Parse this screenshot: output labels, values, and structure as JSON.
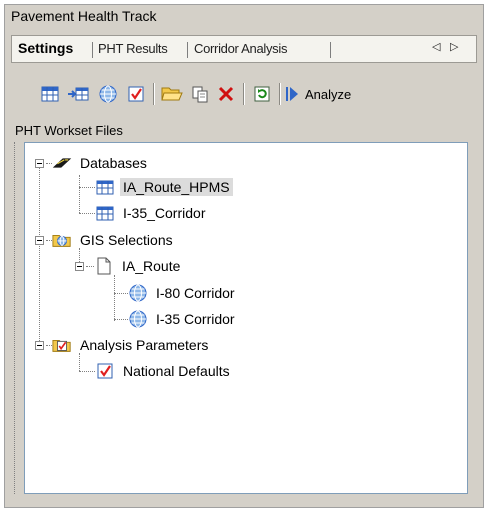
{
  "window": {
    "title": "Pavement Health Track"
  },
  "tabs": [
    {
      "label": "Settings",
      "active": true
    },
    {
      "label": "PHT Results",
      "active": false
    },
    {
      "label": "Corridor Analysis",
      "active": false
    }
  ],
  "toolbar": {
    "buttons": [
      {
        "icon": "table-icon"
      },
      {
        "icon": "import-table-icon"
      },
      {
        "icon": "globe-icon"
      },
      {
        "icon": "checklist-icon"
      },
      {
        "icon": "open-folder-icon"
      },
      {
        "icon": "copy-icon"
      },
      {
        "icon": "delete-icon"
      },
      {
        "icon": "refresh-icon"
      }
    ],
    "analyze_label": "Analyze"
  },
  "section": {
    "label": "PHT Workset Files"
  },
  "tree": {
    "databases": {
      "label": "Databases",
      "children": [
        "IA_Route_HPMS",
        "I-35_Corridor"
      ],
      "selected": "IA_Route_HPMS"
    },
    "gis": {
      "label": "GIS Selections",
      "route": {
        "label": "IA_Route",
        "children": [
          "I-80 Corridor",
          "I-35 Corridor"
        ]
      }
    },
    "analysis": {
      "label": "Analysis Parameters",
      "children": [
        "National Defaults"
      ]
    }
  },
  "colors": {
    "selection": "#dcdcdc",
    "delete_red": "#d01010",
    "check_red": "#e02020",
    "accent_blue": "#2f66c8"
  }
}
